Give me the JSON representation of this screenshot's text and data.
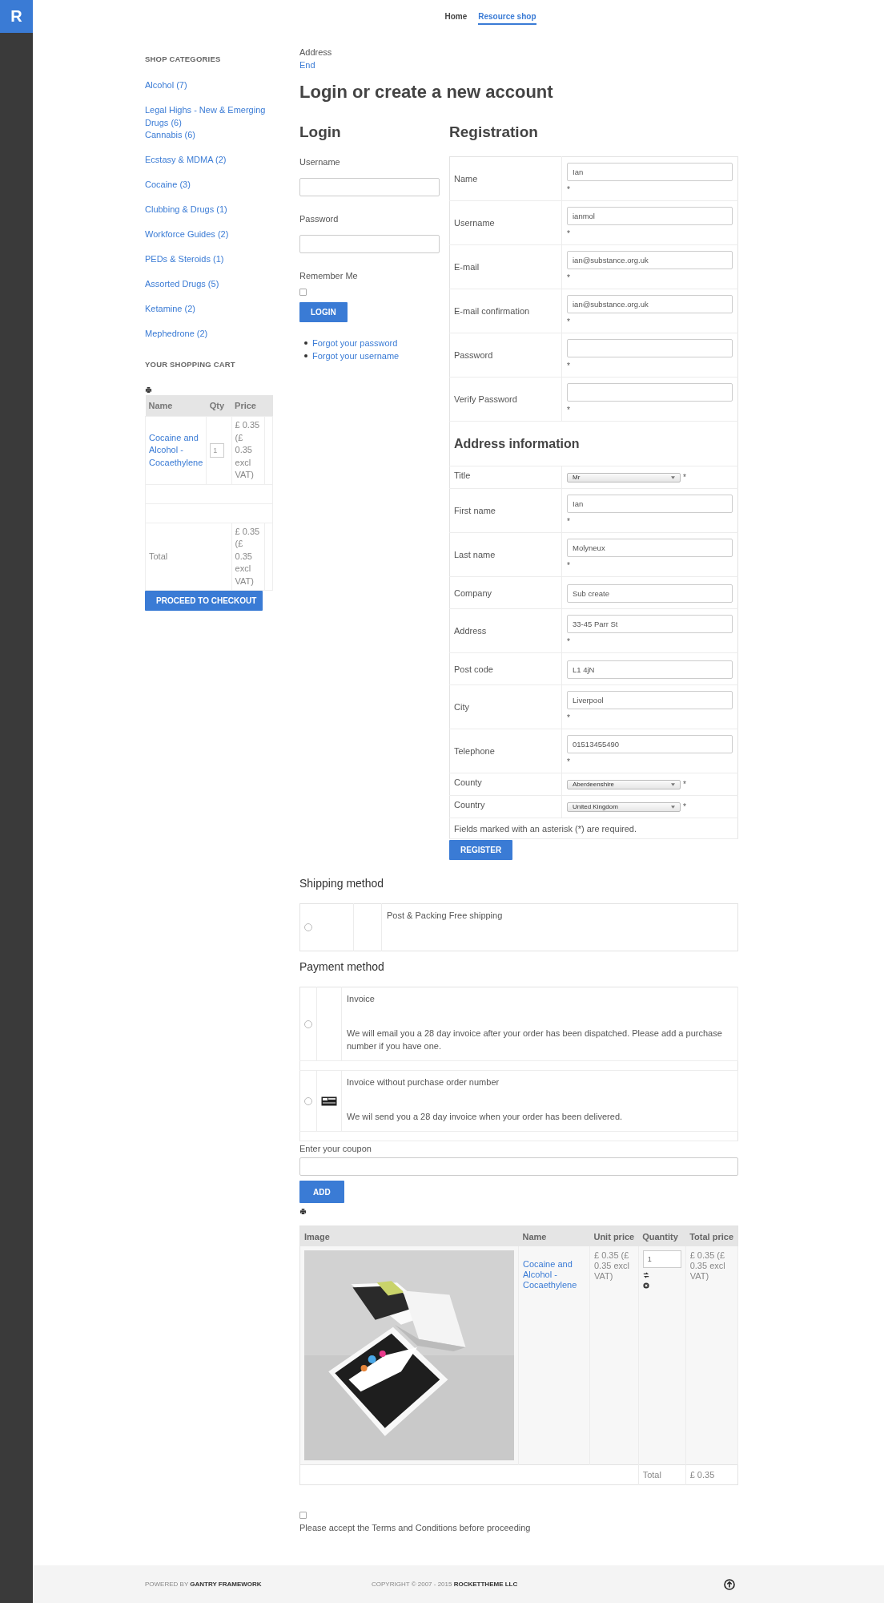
{
  "logo": "R",
  "nav": [
    {
      "label": "Home",
      "selected": false
    },
    {
      "label": "Resource shop",
      "selected": true
    }
  ],
  "sidebar": {
    "categories_title": "SHOP CATEGORIES",
    "categories": [
      "Alcohol (7)",
      "Legal Highs - New & Emerging Drugs (6)",
      "Cannabis (6)",
      "Ecstasy & MDMA (2)",
      "Cocaine (3)",
      "Clubbing & Drugs (1)",
      "Workforce Guides (2)",
      "PEDs & Steroids (1)",
      "Assorted Drugs (5)",
      "Ketamine (2)",
      "Mephedrone (2)"
    ],
    "cart_title": "YOUR SHOPPING CART",
    "cart": {
      "columns": [
        "Name",
        "Qty",
        "Price"
      ],
      "rows": [
        {
          "name": "Cocaine and Alcohol - Cocaethylene",
          "qty": "1",
          "price": "£ 0.35 (£ 0.35 excl VAT)"
        }
      ],
      "total_label": "Total",
      "total": "£ 0.35 (£ 0.35 excl VAT)"
    },
    "checkout_button": "PROCEED TO CHECKOUT"
  },
  "breadcrumb": [
    {
      "label": "Address",
      "kind": "text"
    },
    {
      "label": "End",
      "kind": "link"
    }
  ],
  "page_title": "Login or create a new account",
  "login": {
    "title": "Login",
    "username_label": "Username",
    "password_label": "Password",
    "remember_label": "Remember Me",
    "remember_checked": false,
    "button": "LOGIN",
    "links": [
      "Forgot your password",
      "Forgot your username"
    ]
  },
  "registration": {
    "title": "Registration",
    "fields": [
      {
        "label": "Name",
        "kind": "text",
        "value": "Ian",
        "mark": "*"
      },
      {
        "label": "Username",
        "kind": "text",
        "value": "ianmol",
        "mark": "*"
      },
      {
        "label": "E-mail",
        "kind": "text",
        "value": "ian@substance.org.uk",
        "mark": "*"
      },
      {
        "label": "E-mail confirmation",
        "kind": "text",
        "value": "ian@substance.org.uk",
        "mark": "*"
      },
      {
        "label": "Password",
        "kind": "text",
        "mark": "*"
      },
      {
        "label": "Verify Password",
        "kind": "text",
        "mark": "*"
      }
    ],
    "address_title": "Address information",
    "address_fields": [
      {
        "label": "Title",
        "kind": "select",
        "value": "Mr",
        "mark": "*"
      },
      {
        "label": "First name",
        "kind": "text",
        "value": "Ian",
        "mark": "*"
      },
      {
        "label": "Last name",
        "kind": "text",
        "value": "Molyneux",
        "mark": "*"
      },
      {
        "label": "Company",
        "kind": "text",
        "value": "Sub create"
      },
      {
        "label": "Address",
        "kind": "text",
        "value": "33-45 Parr St",
        "mark": "*"
      },
      {
        "label": "Post code",
        "kind": "text",
        "value": "L1 4jN"
      },
      {
        "label": "City",
        "kind": "text",
        "value": "Liverpool",
        "mark": "*"
      },
      {
        "label": "Telephone",
        "kind": "text",
        "value": "01513455490",
        "mark": "*"
      },
      {
        "label": "County",
        "kind": "select",
        "value": "Aberdeenshire",
        "mark": "*"
      },
      {
        "label": "Country",
        "kind": "select",
        "value": "United Kingdom",
        "mark": "*"
      }
    ],
    "note": "Fields marked with an asterisk (*) are required.",
    "button": "REGISTER"
  },
  "shipping": {
    "title": "Shipping method",
    "options": [
      {
        "label": "Post & Packing Free shipping",
        "selected": false
      }
    ]
  },
  "payment": {
    "title": "Payment method",
    "options": [
      {
        "title": "Invoice",
        "description": "We will email you a 28 day invoice after your order has been dispatched. Please add a purchase number if you have one.",
        "icon": false,
        "selected": false
      },
      {
        "title": "Invoice without purchase order number",
        "description": "We wil send you a 28 day invoice when your order has been delivered.",
        "icon": true,
        "selected": false
      }
    ]
  },
  "coupon": {
    "label": "Enter your coupon",
    "button": "ADD"
  },
  "cart": {
    "columns": [
      "Image",
      "Name",
      "Unit price",
      "Quantity",
      "Total price"
    ],
    "rows": [
      {
        "name": "Cocaine and Alcohol - Cocaethylene",
        "unit_price": "£ 0.35 (£ 0.35 excl VAT)",
        "quantity": "1",
        "total_price": "£ 0.35 (£ 0.35 excl VAT)"
      }
    ],
    "total_label": "Total",
    "total": "£ 0.35"
  },
  "terms": {
    "checked": false,
    "label": "Please accept the Terms and Conditions before proceeding"
  },
  "footer": {
    "left": "POWERED BY **GANTRY FRAMEWORK**",
    "right": "COPYRIGHT © 2007 - 2015 **ROCKETTHEME LLC**"
  }
}
